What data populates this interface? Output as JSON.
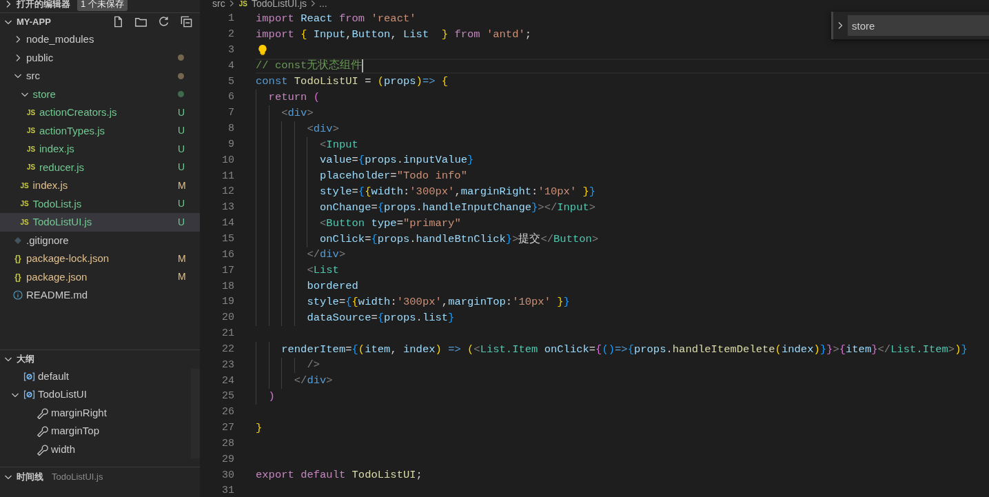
{
  "sidebar": {
    "open_editors": {
      "title": "打开的编辑器",
      "expanded": false,
      "badge": "1 个未保存"
    },
    "explorer": {
      "title": "MY-APP",
      "expanded": true,
      "items": [
        {
          "name": "node_modules",
          "kind": "folder",
          "expanded": false,
          "selected": false
        },
        {
          "name": "public",
          "kind": "folder",
          "expanded": false,
          "dot": {
            "color": "#75664f"
          },
          "selected": false
        },
        {
          "name": "src",
          "kind": "folder",
          "expanded": true,
          "dot": {
            "color": "#75664f"
          },
          "selected": false,
          "children": [
            {
              "name": "store",
              "kind": "folder",
              "expanded": true,
              "dot": {
                "color": "#3f6a4d"
              },
              "color": "#73c991",
              "selected": false,
              "children": [
                {
                  "name": "actionCreators.js",
                  "kind": "js",
                  "icon": "JS",
                  "color": "#73c991",
                  "badge": "U",
                  "selected": false
                },
                {
                  "name": "actionTypes.js",
                  "kind": "js",
                  "icon": "JS",
                  "color": "#73c991",
                  "badge": "U",
                  "selected": false
                },
                {
                  "name": "index.js",
                  "kind": "js",
                  "icon": "JS",
                  "color": "#73c991",
                  "badge": "U",
                  "selected": false
                },
                {
                  "name": "reducer.js",
                  "kind": "js",
                  "icon": "JS",
                  "color": "#73c991",
                  "badge": "U",
                  "selected": false
                }
              ]
            },
            {
              "name": "index.js",
              "kind": "js",
              "icon": "JS",
              "color": "#e2c08d",
              "badge": "M",
              "selected": false
            },
            {
              "name": "TodoList.js",
              "kind": "js",
              "icon": "JS",
              "color": "#73c991",
              "badge": "U",
              "selected": false
            },
            {
              "name": "TodoListUI.js",
              "kind": "js",
              "icon": "JS",
              "color": "#73c991",
              "badge": "U",
              "selected": true
            }
          ]
        },
        {
          "name": ".gitignore",
          "kind": "git",
          "selected": false
        },
        {
          "name": "package-lock.json",
          "kind": "json",
          "icon": "{}",
          "color": "#e2c08d",
          "badge": "M",
          "selected": false
        },
        {
          "name": "package.json",
          "kind": "json",
          "icon": "{}",
          "color": "#e2c08d",
          "badge": "M",
          "selected": false
        },
        {
          "name": "README.md",
          "kind": "info",
          "selected": false
        }
      ]
    },
    "outline": {
      "title": "大纲",
      "expanded": true,
      "items": [
        {
          "name": "default",
          "kind": "variable"
        },
        {
          "name": "TodoListUI",
          "kind": "variable",
          "expanded": true,
          "children": [
            {
              "name": "marginRight",
              "kind": "property"
            },
            {
              "name": "marginTop",
              "kind": "property"
            },
            {
              "name": "width",
              "kind": "property"
            }
          ]
        }
      ]
    },
    "timeline": {
      "title": "时间线",
      "expanded": true,
      "file": "TodoListUI.js"
    }
  },
  "editor": {
    "breadcrumb": [
      {
        "text": "src"
      },
      {
        "text": "TodoListUI.js",
        "icon": "JS"
      },
      {
        "text": "..."
      }
    ],
    "find": {
      "expanded": false,
      "value": "store"
    },
    "lines": [
      {
        "number": "1",
        "tokens": [
          {
            "kind": "kw",
            "text": "import "
          },
          {
            "kind": "var",
            "text": "React "
          },
          {
            "kind": "kw",
            "text": "from "
          },
          {
            "kind": "str",
            "text": "'react'"
          }
        ]
      },
      {
        "number": "2",
        "tokens": [
          {
            "kind": "kw",
            "text": "import "
          },
          {
            "kind": "b1",
            "text": "{ "
          },
          {
            "kind": "var",
            "text": "Input"
          },
          {
            "kind": "text",
            "text": ","
          },
          {
            "kind": "var",
            "text": "Button"
          },
          {
            "kind": "text",
            "text": ", "
          },
          {
            "kind": "var",
            "text": "List  "
          },
          {
            "kind": "b1",
            "text": "} "
          },
          {
            "kind": "kw",
            "text": "from "
          },
          {
            "kind": "str",
            "text": "'antd'"
          },
          {
            "kind": "text",
            "text": ";"
          }
        ]
      },
      {
        "number": "3",
        "lightbulb": true
      },
      {
        "number": "4",
        "current": true,
        "tokens": [
          {
            "kind": "com",
            "text": "// const无状态组件"
          }
        ]
      },
      {
        "number": "5",
        "tokens": [
          {
            "kind": "key",
            "text": "const "
          },
          {
            "kind": "fn",
            "text": "TodoListUI "
          },
          {
            "kind": "text",
            "text": "= "
          },
          {
            "kind": "b1",
            "text": "("
          },
          {
            "kind": "var",
            "text": "props"
          },
          {
            "kind": "b1",
            "text": ")"
          },
          {
            "kind": "key",
            "text": "=> "
          },
          {
            "kind": "b1",
            "text": "{"
          }
        ]
      },
      {
        "number": "6",
        "tokens": [
          {
            "kind": "kw",
            "text": "  return "
          },
          {
            "kind": "b2",
            "text": "("
          }
        ]
      },
      {
        "number": "7",
        "tokens": [
          {
            "kind": "punct",
            "text": "    <"
          },
          {
            "kind": "key",
            "text": "div"
          },
          {
            "kind": "punct",
            "text": ">"
          }
        ]
      },
      {
        "number": "8",
        "tokens": [
          {
            "kind": "punct",
            "text": "        <"
          },
          {
            "kind": "key",
            "text": "div"
          },
          {
            "kind": "punct",
            "text": ">"
          }
        ]
      },
      {
        "number": "9",
        "tokens": [
          {
            "kind": "punct",
            "text": "          <"
          },
          {
            "kind": "comp",
            "text": "Input"
          }
        ]
      },
      {
        "number": "10",
        "tokens": [
          {
            "kind": "var",
            "text": "          value"
          },
          {
            "kind": "text",
            "text": "="
          },
          {
            "kind": "b3",
            "text": "{"
          },
          {
            "kind": "var",
            "text": "props"
          },
          {
            "kind": "text",
            "text": "."
          },
          {
            "kind": "var",
            "text": "inputValue"
          },
          {
            "kind": "b3",
            "text": "}"
          }
        ]
      },
      {
        "number": "11",
        "tokens": [
          {
            "kind": "var",
            "text": "          placeholder"
          },
          {
            "kind": "text",
            "text": "="
          },
          {
            "kind": "str",
            "text": "\"Todo info\""
          }
        ]
      },
      {
        "number": "12",
        "tokens": [
          {
            "kind": "var",
            "text": "          style"
          },
          {
            "kind": "text",
            "text": "="
          },
          {
            "kind": "b3",
            "text": "{"
          },
          {
            "kind": "b1",
            "text": "{"
          },
          {
            "kind": "var",
            "text": "width"
          },
          {
            "kind": "text",
            "text": ":"
          },
          {
            "kind": "str",
            "text": "'300px'"
          },
          {
            "kind": "text",
            "text": ","
          },
          {
            "kind": "var",
            "text": "marginRight"
          },
          {
            "kind": "text",
            "text": ":"
          },
          {
            "kind": "str",
            "text": "'10px' "
          },
          {
            "kind": "b1",
            "text": "}"
          },
          {
            "kind": "b3",
            "text": "}"
          }
        ]
      },
      {
        "number": "13",
        "tokens": [
          {
            "kind": "var",
            "text": "          onChange"
          },
          {
            "kind": "text",
            "text": "="
          },
          {
            "kind": "b3",
            "text": "{"
          },
          {
            "kind": "var",
            "text": "props"
          },
          {
            "kind": "text",
            "text": "."
          },
          {
            "kind": "var",
            "text": "handleInputChange"
          },
          {
            "kind": "b3",
            "text": "}"
          },
          {
            "kind": "punct",
            "text": "></"
          },
          {
            "kind": "comp",
            "text": "Input"
          },
          {
            "kind": "punct",
            "text": ">"
          }
        ]
      },
      {
        "number": "14",
        "tokens": [
          {
            "kind": "punct",
            "text": "          <"
          },
          {
            "kind": "comp",
            "text": "Button "
          },
          {
            "kind": "var",
            "text": "type"
          },
          {
            "kind": "text",
            "text": "="
          },
          {
            "kind": "str",
            "text": "\"primary\""
          }
        ]
      },
      {
        "number": "15",
        "tokens": [
          {
            "kind": "var",
            "text": "          onClick"
          },
          {
            "kind": "text",
            "text": "="
          },
          {
            "kind": "b3",
            "text": "{"
          },
          {
            "kind": "var",
            "text": "props"
          },
          {
            "kind": "text",
            "text": "."
          },
          {
            "kind": "var",
            "text": "handleBtnClick"
          },
          {
            "kind": "b3",
            "text": "}"
          },
          {
            "kind": "punct",
            "text": ">"
          },
          {
            "kind": "text",
            "text": "提交"
          },
          {
            "kind": "punct",
            "text": "</"
          },
          {
            "kind": "comp",
            "text": "Button"
          },
          {
            "kind": "punct",
            "text": ">"
          }
        ]
      },
      {
        "number": "16",
        "tokens": [
          {
            "kind": "punct",
            "text": "        </"
          },
          {
            "kind": "key",
            "text": "div"
          },
          {
            "kind": "punct",
            "text": ">"
          }
        ]
      },
      {
        "number": "17",
        "tokens": [
          {
            "kind": "punct",
            "text": "        <"
          },
          {
            "kind": "comp",
            "text": "List"
          }
        ]
      },
      {
        "number": "18",
        "tokens": [
          {
            "kind": "var",
            "text": "        bordered"
          }
        ]
      },
      {
        "number": "19",
        "tokens": [
          {
            "kind": "var",
            "text": "        style"
          },
          {
            "kind": "text",
            "text": "="
          },
          {
            "kind": "b3",
            "text": "{"
          },
          {
            "kind": "b1",
            "text": "{"
          },
          {
            "kind": "var",
            "text": "width"
          },
          {
            "kind": "text",
            "text": ":"
          },
          {
            "kind": "str",
            "text": "'300px'"
          },
          {
            "kind": "text",
            "text": ","
          },
          {
            "kind": "var",
            "text": "marginTop"
          },
          {
            "kind": "text",
            "text": ":"
          },
          {
            "kind": "str",
            "text": "'10px' "
          },
          {
            "kind": "b1",
            "text": "}"
          },
          {
            "kind": "b3",
            "text": "}"
          }
        ]
      },
      {
        "number": "20",
        "tokens": [
          {
            "kind": "var",
            "text": "        dataSource"
          },
          {
            "kind": "text",
            "text": "="
          },
          {
            "kind": "b3",
            "text": "{"
          },
          {
            "kind": "var",
            "text": "props"
          },
          {
            "kind": "text",
            "text": "."
          },
          {
            "kind": "var",
            "text": "list"
          },
          {
            "kind": "b3",
            "text": "}"
          }
        ]
      },
      {
        "number": "21"
      },
      {
        "number": "22",
        "tokens": [
          {
            "kind": "var",
            "text": "    renderItem"
          },
          {
            "kind": "text",
            "text": "="
          },
          {
            "kind": "b3",
            "text": "{"
          },
          {
            "kind": "b1",
            "text": "("
          },
          {
            "kind": "var",
            "text": "item"
          },
          {
            "kind": "text",
            "text": ", "
          },
          {
            "kind": "var",
            "text": "index"
          },
          {
            "kind": "b1",
            "text": ") "
          },
          {
            "kind": "key",
            "text": "=> "
          },
          {
            "kind": "b1",
            "text": "("
          },
          {
            "kind": "punct",
            "text": "<"
          },
          {
            "kind": "comp",
            "text": "List.Item "
          },
          {
            "kind": "var",
            "text": "onClick"
          },
          {
            "kind": "text",
            "text": "="
          },
          {
            "kind": "b2",
            "text": "{"
          },
          {
            "kind": "b3",
            "text": "()"
          },
          {
            "kind": "key",
            "text": "=>"
          },
          {
            "kind": "b3",
            "text": "{"
          },
          {
            "kind": "var",
            "text": "props"
          },
          {
            "kind": "text",
            "text": "."
          },
          {
            "kind": "fn",
            "text": "handleItemDelete"
          },
          {
            "kind": "b1",
            "text": "("
          },
          {
            "kind": "var",
            "text": "index"
          },
          {
            "kind": "b1",
            "text": ")"
          },
          {
            "kind": "b3",
            "text": "}"
          },
          {
            "kind": "b2",
            "text": "}"
          },
          {
            "kind": "punct",
            "text": ">"
          },
          {
            "kind": "b2",
            "text": "{"
          },
          {
            "kind": "var",
            "text": "item"
          },
          {
            "kind": "b2",
            "text": "}"
          },
          {
            "kind": "punct",
            "text": "</"
          },
          {
            "kind": "comp",
            "text": "List.Item"
          },
          {
            "kind": "punct",
            "text": ">"
          },
          {
            "kind": "b1",
            "text": ")"
          },
          {
            "kind": "b3",
            "text": "}"
          }
        ]
      },
      {
        "number": "23",
        "tokens": [
          {
            "kind": "punct",
            "text": "        />"
          }
        ]
      },
      {
        "number": "24",
        "tokens": [
          {
            "kind": "punct",
            "text": "      </"
          },
          {
            "kind": "key",
            "text": "div"
          },
          {
            "kind": "punct",
            "text": ">"
          }
        ]
      },
      {
        "number": "25",
        "tokens": [
          {
            "kind": "b2",
            "text": "  )"
          }
        ]
      },
      {
        "number": "26"
      },
      {
        "number": "27",
        "tokens": [
          {
            "kind": "b1",
            "text": "}"
          }
        ]
      },
      {
        "number": "28"
      },
      {
        "number": "29"
      },
      {
        "number": "30",
        "tokens": [
          {
            "kind": "kw",
            "text": "export "
          },
          {
            "kind": "kw",
            "text": "default "
          },
          {
            "kind": "fn",
            "text": "TodoListUI"
          },
          {
            "kind": "text",
            "text": ";"
          }
        ]
      },
      {
        "number": "31"
      }
    ]
  }
}
